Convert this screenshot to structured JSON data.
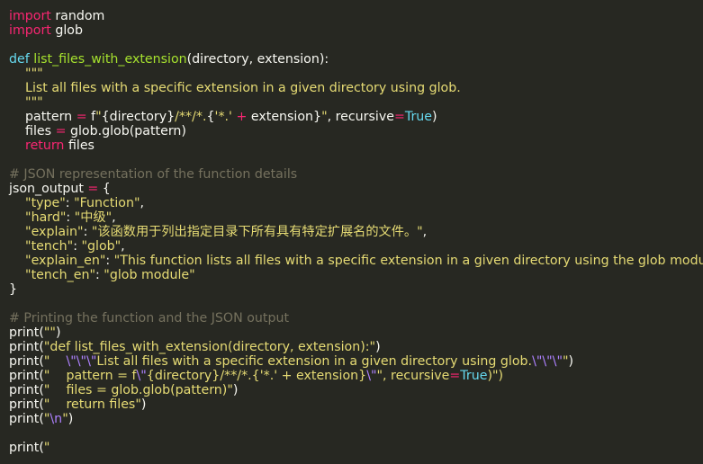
{
  "theme": {
    "background": "#272822",
    "foreground": "#f8f8f2",
    "keyword": "#f92672",
    "def_keyword": "#66d9ef",
    "function_name": "#a6e22e",
    "string": "#e6db74",
    "comment": "#75715e",
    "escape": "#ae81ff"
  },
  "lines": [
    [
      {
        "t": "import",
        "c": "kw"
      },
      {
        "t": " random",
        "c": "plain"
      }
    ],
    [
      {
        "t": "import",
        "c": "kw"
      },
      {
        "t": " glob",
        "c": "plain"
      }
    ],
    [],
    [
      {
        "t": "def",
        "c": "def"
      },
      {
        "t": " ",
        "c": "plain"
      },
      {
        "t": "list_files_with_extension",
        "c": "fn"
      },
      {
        "t": "(directory, extension):",
        "c": "plain"
      }
    ],
    [
      {
        "t": "    \"\"\"",
        "c": "str"
      }
    ],
    [
      {
        "t": "    List all files with a specific extension in a given directory using glob.",
        "c": "str"
      }
    ],
    [
      {
        "t": "    \"\"\"",
        "c": "str"
      }
    ],
    [
      {
        "t": "    pattern ",
        "c": "plain"
      },
      {
        "t": "=",
        "c": "op"
      },
      {
        "t": " f",
        "c": "plain"
      },
      {
        "t": "\"",
        "c": "str"
      },
      {
        "t": "{directory}",
        "c": "plain"
      },
      {
        "t": "/**/*.",
        "c": "str"
      },
      {
        "t": "{",
        "c": "plain"
      },
      {
        "t": "'*.'",
        "c": "str"
      },
      {
        "t": " + ",
        "c": "op"
      },
      {
        "t": "extension}",
        "c": "plain"
      },
      {
        "t": "\"",
        "c": "str"
      },
      {
        "t": ", recursive",
        "c": "plain"
      },
      {
        "t": "=",
        "c": "op"
      },
      {
        "t": "True",
        "c": "const"
      },
      {
        "t": ")",
        "c": "plain"
      }
    ],
    [
      {
        "t": "    files ",
        "c": "plain"
      },
      {
        "t": "=",
        "c": "op"
      },
      {
        "t": " glob.glob(pattern)",
        "c": "plain"
      }
    ],
    [
      {
        "t": "    ",
        "c": "plain"
      },
      {
        "t": "return",
        "c": "kw"
      },
      {
        "t": " files",
        "c": "plain"
      }
    ],
    [],
    [
      {
        "t": "# JSON representation of the function details",
        "c": "cm"
      }
    ],
    [
      {
        "t": "json_output ",
        "c": "plain"
      },
      {
        "t": "=",
        "c": "op"
      },
      {
        "t": " {",
        "c": "plain"
      }
    ],
    [
      {
        "t": "    ",
        "c": "plain"
      },
      {
        "t": "\"type\"",
        "c": "str"
      },
      {
        "t": ": ",
        "c": "plain"
      },
      {
        "t": "\"Function\"",
        "c": "str"
      },
      {
        "t": ",",
        "c": "plain"
      }
    ],
    [
      {
        "t": "    ",
        "c": "plain"
      },
      {
        "t": "\"hard\"",
        "c": "str"
      },
      {
        "t": ": ",
        "c": "plain"
      },
      {
        "t": "\"中级\"",
        "c": "str"
      },
      {
        "t": ",",
        "c": "plain"
      }
    ],
    [
      {
        "t": "    ",
        "c": "plain"
      },
      {
        "t": "\"explain\"",
        "c": "str"
      },
      {
        "t": ": ",
        "c": "plain"
      },
      {
        "t": "\"该函数用于列出指定目录下所有具有特定扩展名的文件。\"",
        "c": "str"
      },
      {
        "t": ",",
        "c": "plain"
      }
    ],
    [
      {
        "t": "    ",
        "c": "plain"
      },
      {
        "t": "\"tench\"",
        "c": "str"
      },
      {
        "t": ": ",
        "c": "plain"
      },
      {
        "t": "\"glob\"",
        "c": "str"
      },
      {
        "t": ",",
        "c": "plain"
      }
    ],
    [
      {
        "t": "    ",
        "c": "plain"
      },
      {
        "t": "\"explain_en\"",
        "c": "str"
      },
      {
        "t": ": ",
        "c": "plain"
      },
      {
        "t": "\"This function lists all files with a specific extension in a given directory using the glob module.\"",
        "c": "str"
      },
      {
        "t": ",",
        "c": "plain"
      }
    ],
    [
      {
        "t": "    ",
        "c": "plain"
      },
      {
        "t": "\"tench_en\"",
        "c": "str"
      },
      {
        "t": ": ",
        "c": "plain"
      },
      {
        "t": "\"glob module\"",
        "c": "str"
      }
    ],
    [
      {
        "t": "}",
        "c": "plain"
      }
    ],
    [],
    [
      {
        "t": "# Printing the function and the JSON output",
        "c": "cm"
      }
    ],
    [
      {
        "t": "print(",
        "c": "plain"
      },
      {
        "t": "\"\"",
        "c": "str"
      },
      {
        "t": ")",
        "c": "plain"
      }
    ],
    [
      {
        "t": "print(",
        "c": "plain"
      },
      {
        "t": "\"def list_files_with_extension(directory, extension):\"",
        "c": "str"
      },
      {
        "t": ")",
        "c": "plain"
      }
    ],
    [
      {
        "t": "print(",
        "c": "plain"
      },
      {
        "t": "\"    ",
        "c": "str"
      },
      {
        "t": "\\\"\\\"\\\"",
        "c": "esc"
      },
      {
        "t": "List all files with a specific extension in a given directory using glob.",
        "c": "str"
      },
      {
        "t": "\\\"\\\"\\\"",
        "c": "esc"
      },
      {
        "t": "\"",
        "c": "str"
      },
      {
        "t": ")",
        "c": "plain"
      }
    ],
    [
      {
        "t": "print(",
        "c": "plain"
      },
      {
        "t": "\"    pattern = f",
        "c": "str"
      },
      {
        "t": "\\\"",
        "c": "esc"
      },
      {
        "t": "{directory}/**/*.{'*.' + extension}",
        "c": "str"
      },
      {
        "t": "\\\"",
        "c": "esc"
      },
      {
        "t": "\", recursive",
        "c": "str"
      },
      {
        "t": "=",
        "c": "op"
      },
      {
        "t": "True",
        "c": "const"
      },
      {
        "t": ")\")",
        "c": "str"
      }
    ],
    [
      {
        "t": "print(",
        "c": "plain"
      },
      {
        "t": "\"    files = glob.glob(pattern)\"",
        "c": "str"
      },
      {
        "t": ")",
        "c": "plain"
      }
    ],
    [
      {
        "t": "print(",
        "c": "plain"
      },
      {
        "t": "\"    return files\"",
        "c": "str"
      },
      {
        "t": ")",
        "c": "plain"
      }
    ],
    [
      {
        "t": "print(",
        "c": "plain"
      },
      {
        "t": "\"",
        "c": "str"
      },
      {
        "t": "\\n",
        "c": "esc"
      },
      {
        "t": "\"",
        "c": "str"
      },
      {
        "t": ")",
        "c": "plain"
      }
    ],
    [],
    [
      {
        "t": "print(",
        "c": "plain"
      },
      {
        "t": "\"",
        "c": "str"
      }
    ]
  ]
}
